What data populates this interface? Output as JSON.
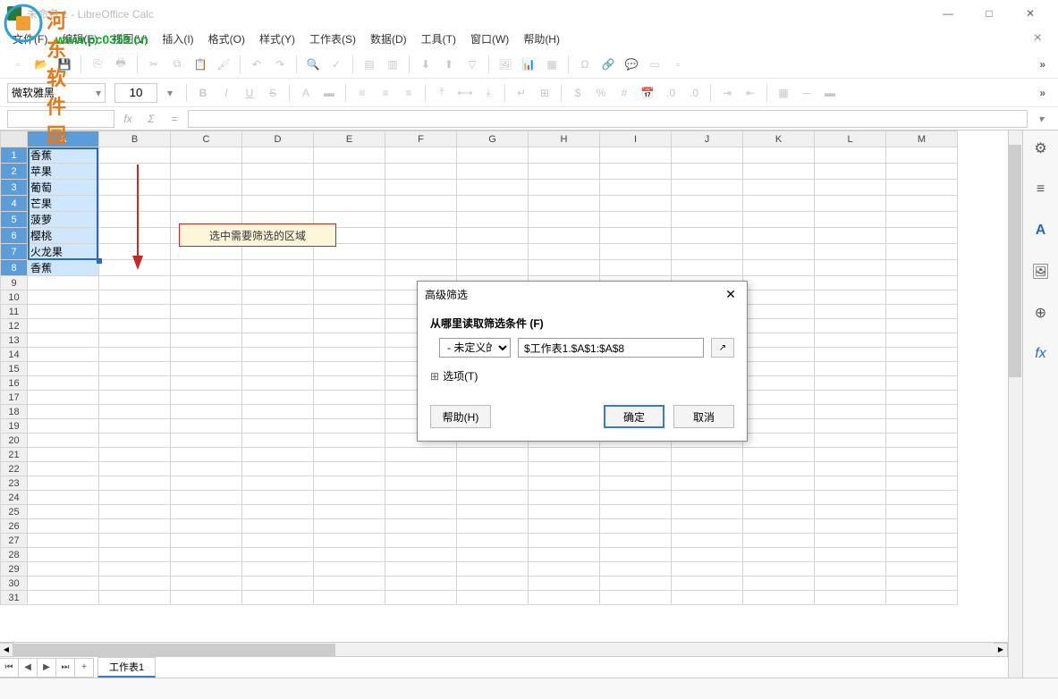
{
  "window": {
    "title": "未命名 1 - LibreOffice Calc"
  },
  "watermark": {
    "name": "河东软件园",
    "url": "www.pc0359.cn"
  },
  "menu": {
    "file": "文件(F)",
    "edit": "编辑(E)",
    "view": "视图(V)",
    "insert": "插入(I)",
    "format": "格式(O)",
    "style": "样式(Y)",
    "sheet": "工作表(S)",
    "data": "数据(D)",
    "tools": "工具(T)",
    "window": "窗口(W)",
    "help": "帮助(H)"
  },
  "formatbar": {
    "font": "微软雅黑",
    "size": "10"
  },
  "namebox": "",
  "columns": [
    "A",
    "B",
    "C",
    "D",
    "E",
    "F",
    "G",
    "H",
    "I",
    "J",
    "K",
    "L",
    "M"
  ],
  "cells": {
    "A1": "香蕉",
    "A2": "苹果",
    "A3": "葡萄",
    "A4": "芒果",
    "A5": "菠萝",
    "A6": "樱桃",
    "A7": "火龙果",
    "A8": "香蕉"
  },
  "rows_visible": 31,
  "annotation": {
    "text": "选中需要筛选的区域"
  },
  "dialog": {
    "title": "高级筛选",
    "from_label": "从哪里读取筛选条件 (F)",
    "undefined_option": "- 未定义的 -",
    "range": "$工作表1.$A$1:$A$8",
    "options_label": "选项(T)",
    "help": "帮助(H)",
    "ok": "确定",
    "cancel": "取消"
  },
  "sheet_tab": "工作表1"
}
